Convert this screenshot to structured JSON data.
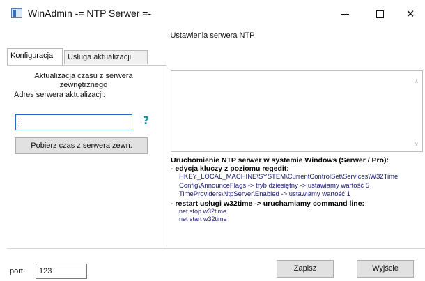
{
  "window": {
    "title": "WinAdmin -= NTP Serwer =-",
    "icon": "app-window-icon",
    "minimize_glyph": "",
    "close_glyph": "✕"
  },
  "header": {
    "label": "Ustawienia serwera NTP"
  },
  "tabs": [
    {
      "label": "Konfiguracja",
      "active": true
    },
    {
      "label": "Usługa aktualizacji",
      "active": false
    }
  ],
  "left_panel": {
    "sync_heading": "Aktualizacja czasu z serwera zewnętrznego",
    "server_label": "Adres serwera aktualizacji:",
    "server_value": "",
    "help_glyph": "?",
    "fetch_button": "Pobierz czas z serwera zewn."
  },
  "right_panel": {
    "log_text": "",
    "scroll_up_glyph": "∧",
    "scroll_down_glyph": "∨",
    "info_lines": [
      {
        "text": "Uruchomienie NTP serwer w systemie Windows (Serwer / Pro):",
        "style": "bold"
      },
      {
        "text": "- edycja kluczy z poziomu regedit:",
        "style": "bold"
      },
      {
        "text": "HKEY_LOCAL_MACHINE\\SYSTEM\\CurrentControlSet\\Services\\W32Time",
        "style": "item"
      },
      {
        "text": "Config\\AnnounceFlags -> tryb dziesiętny -> ustawiamy wartość 5",
        "style": "item"
      },
      {
        "text": "TimeProviders\\NtpServer\\Enabled -> ustawiamy wartość 1",
        "style": "item"
      },
      {
        "text": "- restart usługi w32time -> uruchamiamy command line:",
        "style": "bold"
      },
      {
        "text": "net stop w32time",
        "style": "cmd"
      },
      {
        "text": "net start w32time",
        "style": "cmd"
      }
    ]
  },
  "footer": {
    "port_label": "port:",
    "port_value": "123",
    "save_button": "Zapisz",
    "exit_button": "Wyjście"
  },
  "colors": {
    "help_icon": "#1b8f9a",
    "input_focus_border": "#2a66c7",
    "info_text": "#1a1a70"
  }
}
